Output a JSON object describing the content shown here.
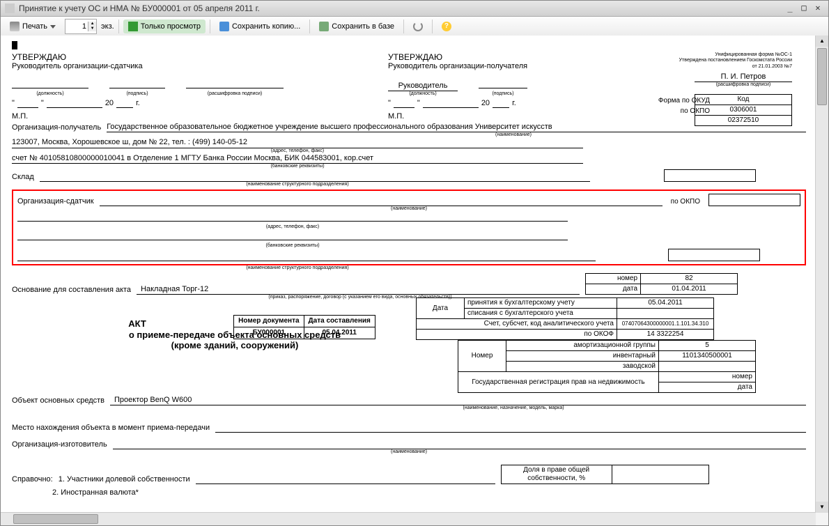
{
  "window_title": "Принятие к учету ОС и НМА № БУ000001 от 05 апреля 2011 г.",
  "toolbar": {
    "print": "Печать",
    "copies_value": "1",
    "copies_suffix": "экз.",
    "only_view": "Только просмотр",
    "save_copy": "Сохранить копию...",
    "save_db": "Сохранить в базе"
  },
  "form_header": {
    "form_name": "Унифицированная форма №ОС-1",
    "approved_by": "Утверждена постановлением Госкомстата России",
    "approved_date": "от 21.01.2003 №7",
    "signer": "П. И. Петров"
  },
  "approve": {
    "title": "УТВЕРЖДАЮ",
    "sender_head": "Руководитель организации-сдатчика",
    "receiver_head": "Руководитель организации-получателя",
    "position_hint": "(должность)",
    "sign_hint": "(подпись)",
    "name_hint": "(расшифровка подписи)",
    "director": "Руководитель",
    "date_quote_l": "\"",
    "date_quote_r": "\"",
    "year_prefix": "20",
    "year_suffix": "г.",
    "mp": "М.П."
  },
  "codes": {
    "code_label": "Код",
    "okud_label": "Форма по ОКУД",
    "okud": "0306001",
    "okpo_label": "по ОКПО",
    "okpo": "02372510",
    "okof_label": "по ОКОФ",
    "okof": "14 3322254"
  },
  "org": {
    "receiver_label": "Организация-получатель",
    "receiver_name": "Государственное образовательное бюджетное учреждение высшего профессионального образования Университет искусств",
    "name_hint": "(наименование)",
    "address": "123007, Москва, Хорошевское ш, дом № 22, тел. : (499) 140-05-12",
    "address_hint": "(адрес, телефон, факс)",
    "bank": "счет № 40105810800000010041 в Отделение 1 МГТУ Банка России Москва, БИК 044583001, кор.счет",
    "bank_hint": "(банковские реквизиты)",
    "warehouse_label": "Склад",
    "dept_hint": "(наименование структурного подразделения)",
    "sender_label": "Организация-сдатчик"
  },
  "basis": {
    "label": "Основание для составления акта",
    "value": "Накладная Торг-12",
    "hint": "(приказ, распоряжение, договор (с указанием его вида, основных обязательств))",
    "num_label": "номер",
    "num": "82",
    "date_label": "дата",
    "date": "01.04.2011"
  },
  "dates": {
    "label": "Дата",
    "accept": "принятия к бухгалтерскому учету",
    "accept_val": "05.04.2011",
    "writeoff": "списания с бухгалтерского учета",
    "account_label": "Счет, субсчет, код аналитического учета",
    "account_val": "07407064300000001.1.101.34.310"
  },
  "act": {
    "doc_num_label": "Номер документа",
    "doc_num": "БУ000001",
    "doc_date_label": "Дата составления",
    "doc_date": "05.04.2011",
    "title": "АКТ",
    "subtitle1": "о приеме-передаче объекта основных средств",
    "subtitle2": "(кроме зданий, сооружений)"
  },
  "number_block": {
    "label": "Номер",
    "amort_group": "амортизационной группы",
    "amort_val": "5",
    "inventory": "инвентарный",
    "inventory_val": "1101340500001",
    "factory": "заводской",
    "reg_label": "Государственная регистрация прав на недвижимость",
    "reg_num": "номер",
    "reg_date": "дата"
  },
  "object": {
    "label": "Объект основных средств",
    "name": "Проектор BenQ W600",
    "hint": "(наименование, назначение, модель, марка)",
    "location_label": "Место нахождения объекта в момент приема-передачи",
    "manufacturer_label": "Организация-изготовитель",
    "manufacturer_hint": "(наименование)"
  },
  "reference": {
    "label": "Справочно:",
    "item1": "1. Участники долевой собственности",
    "share_label": "Доля в праве общей собственности, %",
    "item2": "2. Иностранная валюта*"
  }
}
